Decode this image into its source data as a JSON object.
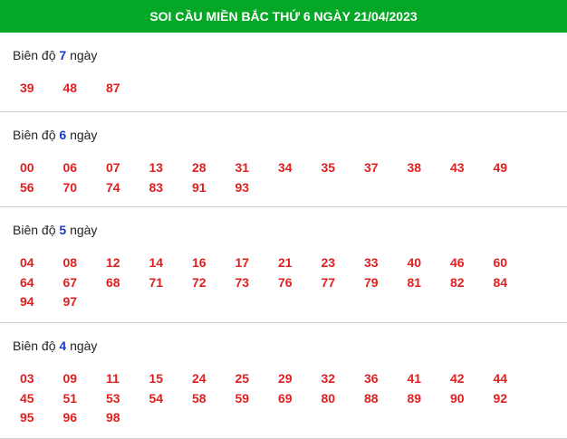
{
  "header": {
    "title": "SOI CẦU MIỀN BẮC THỨ 6 NGÀY 21/04/2023"
  },
  "sections": [
    {
      "prefix": "Biên độ",
      "value": "7",
      "suffix": "ngày",
      "numbers": [
        "39",
        "48",
        "87"
      ]
    },
    {
      "prefix": "Biên độ",
      "value": "6",
      "suffix": "ngày",
      "numbers": [
        "00",
        "06",
        "07",
        "13",
        "28",
        "31",
        "34",
        "35",
        "37",
        "38",
        "43",
        "49",
        "56",
        "70",
        "74",
        "83",
        "91",
        "93"
      ]
    },
    {
      "prefix": "Biên độ",
      "value": "5",
      "suffix": "ngày",
      "numbers": [
        "04",
        "08",
        "12",
        "14",
        "16",
        "17",
        "21",
        "23",
        "33",
        "40",
        "46",
        "60",
        "64",
        "67",
        "68",
        "71",
        "72",
        "73",
        "76",
        "77",
        "79",
        "81",
        "82",
        "84",
        "94",
        "97"
      ]
    },
    {
      "prefix": "Biên độ",
      "value": "4",
      "suffix": "ngày",
      "numbers": [
        "03",
        "09",
        "11",
        "15",
        "24",
        "25",
        "29",
        "32",
        "36",
        "41",
        "42",
        "44",
        "45",
        "51",
        "53",
        "54",
        "58",
        "59",
        "69",
        "80",
        "88",
        "89",
        "90",
        "92",
        "95",
        "96",
        "98"
      ]
    }
  ]
}
